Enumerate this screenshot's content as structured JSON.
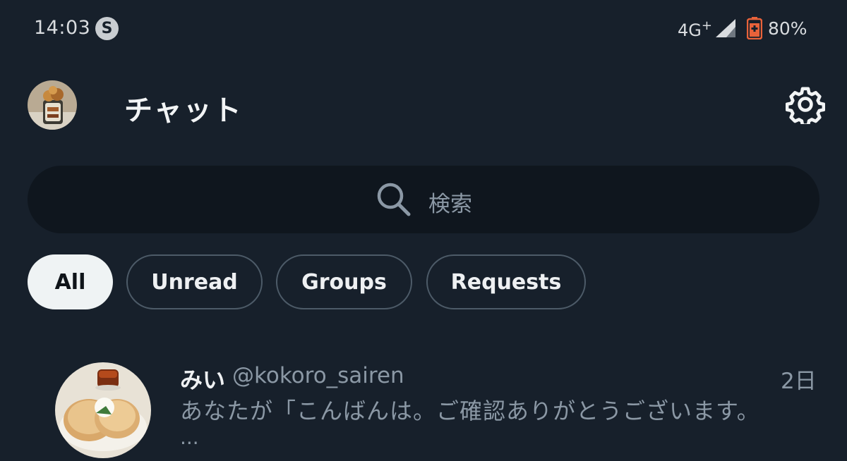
{
  "status_bar": {
    "time": "14:03",
    "app_icon_glyph": "S",
    "network": "4G",
    "network_plus": "+",
    "battery_percent": "80%",
    "battery_color": "#e8623a"
  },
  "header": {
    "title": "チャット",
    "profile_icon": "avatar",
    "settings_icon": "gear-icon"
  },
  "search": {
    "placeholder": "検索",
    "icon": "search-icon"
  },
  "filters": [
    {
      "label": "All",
      "active": true
    },
    {
      "label": "Unread",
      "active": false
    },
    {
      "label": "Groups",
      "active": false
    },
    {
      "label": "Requests",
      "active": false
    }
  ],
  "conversations": [
    {
      "name": "みい",
      "handle": "@kokoro_sairen",
      "time": "2日",
      "preview": "あなたが「こんばんは。ご確認ありがとうございます。",
      "ellipsis": "..."
    }
  ],
  "colors": {
    "background": "#17202b",
    "search_background": "#0f161e",
    "chip_active_bg": "#eff3f4",
    "chip_border": "#4d5b68",
    "muted_text": "#8b98a5"
  }
}
